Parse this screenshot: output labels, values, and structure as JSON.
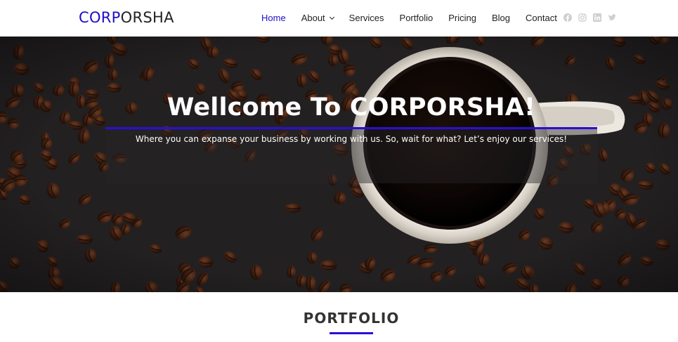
{
  "brand": {
    "part1": "CORP",
    "part2": "ORSHA",
    "accent": "#1e0ec8"
  },
  "nav": {
    "items": [
      {
        "label": "Home",
        "active": true
      },
      {
        "label": "About",
        "dropdown": true
      },
      {
        "label": "Services"
      },
      {
        "label": "Portfolio"
      },
      {
        "label": "Pricing"
      },
      {
        "label": "Blog"
      },
      {
        "label": "Contact"
      }
    ]
  },
  "social": {
    "icons": [
      "facebook-icon",
      "instagram-icon",
      "linkedin-icon",
      "twitter-icon"
    ],
    "color": "#cccccc"
  },
  "hero": {
    "title": "Wellcome To CORPORSHA!",
    "subtitle": "Where you can expanse your business by working with us. So, wait for what? Let’s enjoy our services!",
    "bar_color": "#2a0fd6"
  },
  "portfolio": {
    "title": "PORTFOLIO"
  }
}
